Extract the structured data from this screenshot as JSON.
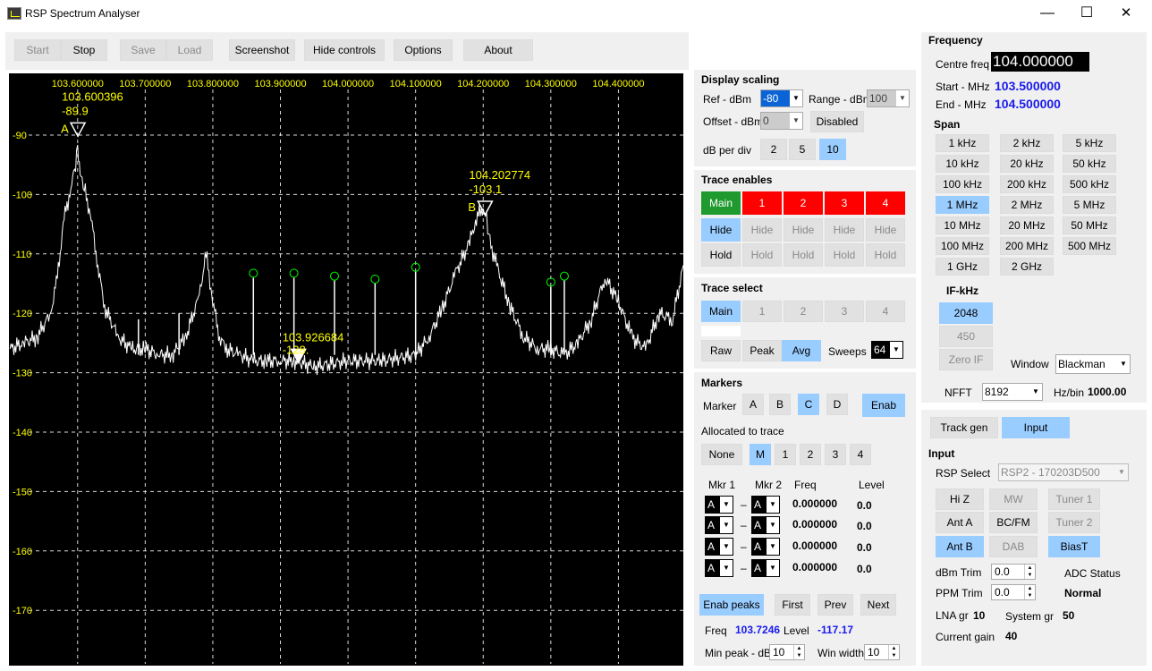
{
  "window": {
    "title": "RSP Spectrum Analyser",
    "minimize": "—",
    "maximize": "☐",
    "close": "✕"
  },
  "toolbar": {
    "start": "Start",
    "stop": "Stop",
    "save": "Save",
    "load": "Load",
    "screenshot": "Screenshot",
    "hide_controls": "Hide controls",
    "options": "Options",
    "about": "About"
  },
  "chart_data": {
    "type": "line",
    "x_ticks": [
      "103.600000",
      "103.700000",
      "103.800000",
      "103.900000",
      "104.000000",
      "104.100000",
      "104.200000",
      "104.300000",
      "104.400000"
    ],
    "x_tick_values": [
      103.6,
      103.7,
      103.8,
      103.9,
      104.0,
      104.1,
      104.2,
      104.3,
      104.4
    ],
    "y_ticks": [
      "-90",
      "-100",
      "-110",
      "-120",
      "-130",
      "-140",
      "-150",
      "-160",
      "-170"
    ],
    "y_tick_values": [
      -90,
      -100,
      -110,
      -120,
      -130,
      -140,
      -150,
      -160,
      -170
    ],
    "xlim": [
      103.5,
      104.5
    ],
    "ylim": [
      -180,
      -80
    ],
    "grid": true,
    "series": [
      {
        "x": [
          103.5,
          103.52,
          103.54,
          103.56,
          103.57,
          103.58,
          103.59,
          103.5955,
          103.6,
          103.605,
          103.61,
          103.62,
          103.63,
          103.64,
          103.66,
          103.68,
          103.7,
          103.72,
          103.74,
          103.76,
          103.78,
          103.79,
          103.8,
          103.81,
          103.82,
          103.84,
          103.86,
          103.88,
          103.9,
          103.92,
          103.95,
          104.0,
          104.05,
          104.1,
          104.12,
          104.14,
          104.16,
          104.18,
          104.19,
          104.2,
          104.205,
          104.21,
          104.22,
          104.24,
          104.26,
          104.28,
          104.3,
          104.32,
          104.34,
          104.36,
          104.38,
          104.4,
          104.42,
          104.44,
          104.46,
          104.48,
          104.5
        ],
        "y": [
          -126,
          -125,
          -124,
          -120,
          -114,
          -104,
          -99,
          -96,
          -92,
          -97,
          -99,
          -104,
          -112,
          -119,
          -124,
          -126,
          -126,
          -127,
          -127,
          -124,
          -117,
          -110,
          -118,
          -124,
          -126,
          -127,
          -128,
          -128,
          -128,
          -128,
          -129,
          -128,
          -128,
          -127,
          -124,
          -119,
          -113,
          -108,
          -104,
          -102,
          -104,
          -108,
          -112,
          -119,
          -124,
          -126,
          -126,
          -127,
          -125,
          -121,
          -114,
          -118,
          -124,
          -126,
          -120,
          -121,
          -110
        ]
      }
    ],
    "spurs": [
      {
        "x": 103.69,
        "y": -121
      },
      {
        "x": 103.75,
        "y": -120
      },
      {
        "x": 103.86,
        "y": -114
      },
      {
        "x": 103.92,
        "y": -114
      },
      {
        "x": 103.98,
        "y": -114.5
      },
      {
        "x": 104.04,
        "y": -115
      },
      {
        "x": 104.1,
        "y": -113
      },
      {
        "x": 104.3,
        "y": -115.5
      },
      {
        "x": 104.32,
        "y": -114.5
      }
    ],
    "peak_markers": [
      {
        "x": 103.86,
        "y": -114
      },
      {
        "x": 103.92,
        "y": -114
      },
      {
        "x": 103.98,
        "y": -114.5
      },
      {
        "x": 104.04,
        "y": -115
      },
      {
        "x": 104.1,
        "y": -113
      },
      {
        "x": 104.3,
        "y": -115.5
      },
      {
        "x": 104.32,
        "y": -114.5
      }
    ],
    "markers": [
      {
        "letter": "A",
        "freq": "103.600396",
        "level": "-89.9",
        "x": 103.6004,
        "y": -89.9
      },
      {
        "letter": "B",
        "freq": "104.202774",
        "level": "-103.1",
        "x": 104.2028,
        "y": -103.1
      },
      {
        "letter": "",
        "freq": "103.926684",
        "level": "-128.",
        "x": 103.9267,
        "y": -128
      }
    ]
  },
  "display_scaling": {
    "title": "Display scaling",
    "ref_label": "Ref - dBm",
    "ref_value": "-80",
    "range_label": "Range - dBm",
    "range_value": "100",
    "offset_label": "Offset - dBm",
    "offset_value": "0",
    "disabled": "Disabled",
    "dbdiv_label": "dB per div",
    "dbdiv_options": [
      "2",
      "5",
      "10"
    ]
  },
  "trace_enables": {
    "title": "Trace enables",
    "traces": [
      "Main",
      "1",
      "2",
      "3",
      "4"
    ],
    "hide": "Hide",
    "hold": "Hold"
  },
  "trace_select": {
    "title": "Trace select",
    "traces": [
      "Main",
      "1",
      "2",
      "3",
      "4"
    ],
    "raw": "Raw",
    "peak": "Peak",
    "avg": "Avg",
    "sweeps_label": "Sweeps",
    "sweeps_value": "64"
  },
  "markers": {
    "title": "Markers",
    "marker_label": "Marker",
    "letters": [
      "A",
      "B",
      "C",
      "D"
    ],
    "enab": "Enab",
    "allocated_label": "Allocated to trace",
    "alloc": [
      "None",
      "M",
      "1",
      "2",
      "3",
      "4"
    ],
    "mkr1": "Mkr 1",
    "mkr2": "Mkr 2",
    "freq_h": "Freq",
    "level_h": "Level",
    "dash": "–",
    "sel_a": "A",
    "rows": [
      {
        "freq": "0.000000",
        "level": "0.0"
      },
      {
        "freq": "0.000000",
        "level": "0.0"
      },
      {
        "freq": "0.000000",
        "level": "0.0"
      },
      {
        "freq": "0.000000",
        "level": "0.0"
      }
    ],
    "enab_peaks": "Enab peaks",
    "first": "First",
    "prev": "Prev",
    "next": "Next",
    "freq_label": "Freq",
    "freq_value": "103.7246",
    "level_label": "Level",
    "level_value": "-117.17",
    "minpeak_label": "Min peak - dB",
    "minpeak_value": "10",
    "winwidth_label": "Win width",
    "winwidth_value": "10"
  },
  "frequency": {
    "title": "Frequency",
    "centre_label": "Centre freq",
    "centre_value": "104.000000",
    "start_label": "Start - MHz",
    "start_value": "103.500000",
    "end_label": "End - MHz",
    "end_value": "104.500000"
  },
  "span": {
    "title": "Span",
    "buttons": [
      "1 kHz",
      "2 kHz",
      "5 kHz",
      "10 kHz",
      "20 kHz",
      "50 kHz",
      "100 kHz",
      "200 kHz",
      "500 kHz",
      "1 MHz",
      "2 MHz",
      "5 MHz",
      "10 MHz",
      "20 MHz",
      "50 MHz",
      "100 MHz",
      "200 MHz",
      "500 MHz",
      "1 GHz",
      "2 GHz"
    ]
  },
  "if": {
    "title": "IF-kHz",
    "opt1": "2048",
    "opt2": "450",
    "zero_if": "Zero IF",
    "window_label": "Window",
    "window_value": "Blackman",
    "nfft_label": "NFFT",
    "nfft_value": "8192",
    "hzbin_label": "Hz/bin",
    "hzbin_value": "1000.00"
  },
  "tabs": {
    "track_gen": "Track gen",
    "input": "Input"
  },
  "input": {
    "title": "Input",
    "rsp_label": "RSP Select",
    "rsp_value": "RSP2 - 170203D500",
    "hiz": "Hi Z",
    "mw": "MW",
    "tuner1": "Tuner 1",
    "anta": "Ant A",
    "bcfm": "BC/FM",
    "tuner2": "Tuner 2",
    "antb": "Ant B",
    "dab": "DAB",
    "biast": "BiasT",
    "dbm_trim_label": "dBm Trim",
    "dbm_trim_value": "0.0",
    "adc_label": "ADC Status",
    "ppm_trim_label": "PPM Trim",
    "ppm_trim_value": "0.0",
    "adc_value": "Normal",
    "lna_label": "LNA gr",
    "lna_value": "10",
    "sys_label": "System gr",
    "sys_value": "50",
    "cur_label": "Current gain",
    "cur_value": "40"
  },
  "colors": {
    "plot_bg": "#000000",
    "trace": "#ffffff",
    "grid": "#ffffff",
    "axis_text": "#ffff00",
    "marker_text": "#ffff00",
    "peak_circle": "#00ff00",
    "accent": "#99ccff",
    "value_blue": "#1a1aee"
  }
}
